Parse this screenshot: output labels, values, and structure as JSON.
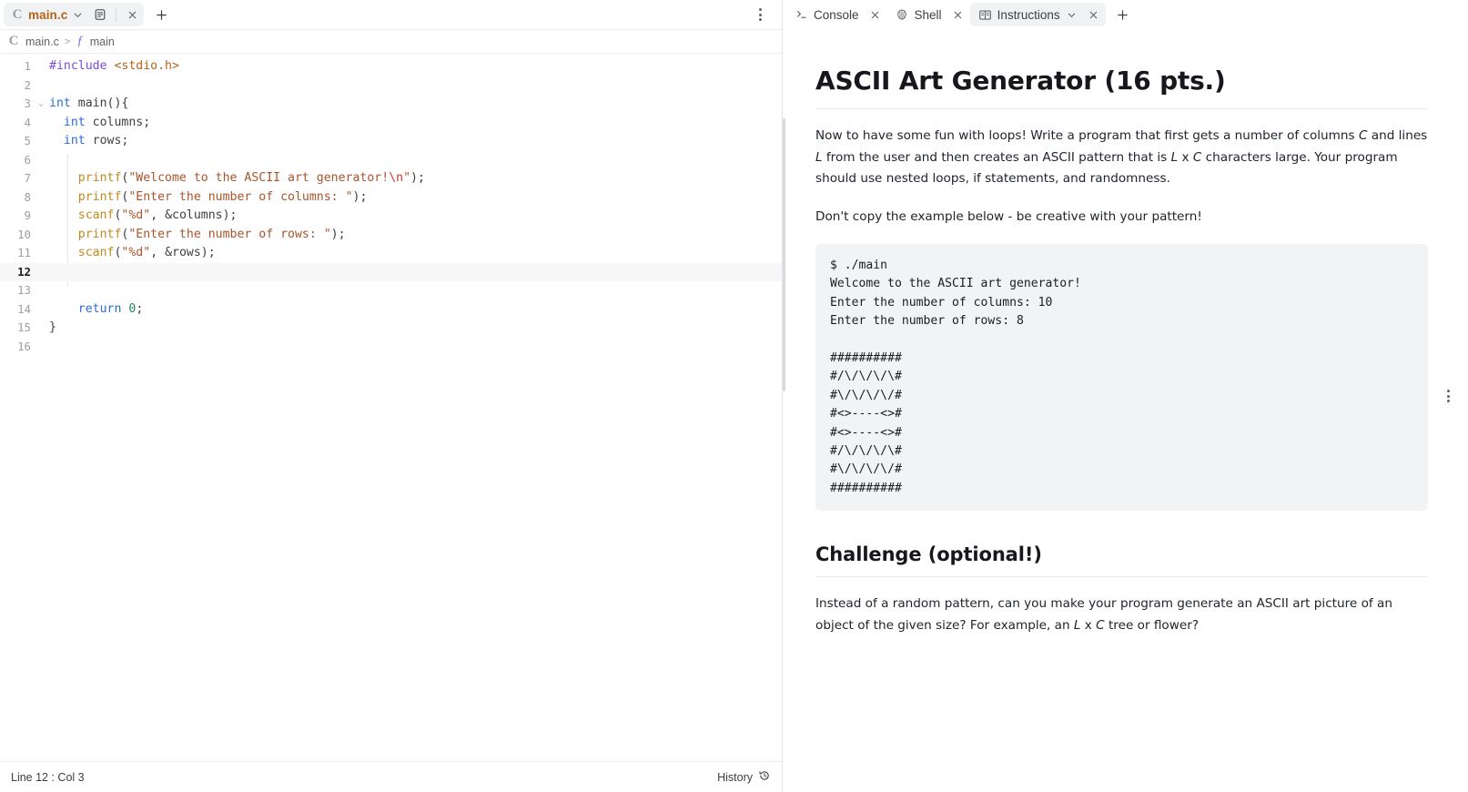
{
  "editor": {
    "tab": {
      "filename": "main.c",
      "language_icon": "c-language-icon",
      "chevron_icon": "chevron-down-icon",
      "preview_icon": "file-preview-icon",
      "close_icon": "close-icon"
    },
    "new_tab_label": "+",
    "breadcrumb": {
      "file": "main.c",
      "separator": ">",
      "symbol": "main",
      "function_glyph": "ƒ"
    },
    "status": {
      "position": "Line 12 : Col 3",
      "history_label": "History"
    },
    "lines": [
      {
        "n": "1",
        "fold": "",
        "current": false,
        "tokens": [
          {
            "t": "#include ",
            "c": "t-pre"
          },
          {
            "t": "<stdio.h>",
            "c": "t-inc"
          }
        ]
      },
      {
        "n": "2",
        "fold": "",
        "current": false,
        "tokens": []
      },
      {
        "n": "3",
        "fold": "v",
        "current": false,
        "tokens": [
          {
            "t": "int",
            "c": "t-kw"
          },
          {
            "t": " main(){",
            "c": "t-punct"
          }
        ]
      },
      {
        "n": "4",
        "fold": "",
        "current": false,
        "tokens": [
          {
            "t": "  ",
            "c": ""
          },
          {
            "t": "int",
            "c": "t-kw"
          },
          {
            "t": " columns;",
            "c": "t-punct"
          }
        ]
      },
      {
        "n": "5",
        "fold": "",
        "current": false,
        "tokens": [
          {
            "t": "  ",
            "c": ""
          },
          {
            "t": "int",
            "c": "t-kw"
          },
          {
            "t": " rows;",
            "c": "t-punct"
          }
        ]
      },
      {
        "n": "6",
        "fold": "",
        "current": false,
        "tokens": []
      },
      {
        "n": "7",
        "fold": "",
        "current": false,
        "tokens": [
          {
            "t": "    ",
            "c": ""
          },
          {
            "t": "printf",
            "c": "t-fn"
          },
          {
            "t": "(",
            "c": "t-punct"
          },
          {
            "t": "\"Welcome to the ASCII art generator!",
            "c": "t-str"
          },
          {
            "t": "\\n",
            "c": "t-esc"
          },
          {
            "t": "\"",
            "c": "t-str"
          },
          {
            "t": ");",
            "c": "t-punct"
          }
        ]
      },
      {
        "n": "8",
        "fold": "",
        "current": false,
        "tokens": [
          {
            "t": "    ",
            "c": ""
          },
          {
            "t": "printf",
            "c": "t-fn"
          },
          {
            "t": "(",
            "c": "t-punct"
          },
          {
            "t": "\"Enter the number of columns: \"",
            "c": "t-str"
          },
          {
            "t": ");",
            "c": "t-punct"
          }
        ]
      },
      {
        "n": "9",
        "fold": "",
        "current": false,
        "tokens": [
          {
            "t": "    ",
            "c": ""
          },
          {
            "t": "scanf",
            "c": "t-fn"
          },
          {
            "t": "(",
            "c": "t-punct"
          },
          {
            "t": "\"%d\"",
            "c": "t-str"
          },
          {
            "t": ", &columns);",
            "c": "t-punct"
          }
        ]
      },
      {
        "n": "10",
        "fold": "",
        "current": false,
        "tokens": [
          {
            "t": "    ",
            "c": ""
          },
          {
            "t": "printf",
            "c": "t-fn"
          },
          {
            "t": "(",
            "c": "t-punct"
          },
          {
            "t": "\"Enter the number of rows: \"",
            "c": "t-str"
          },
          {
            "t": ");",
            "c": "t-punct"
          }
        ]
      },
      {
        "n": "11",
        "fold": "",
        "current": false,
        "tokens": [
          {
            "t": "    ",
            "c": ""
          },
          {
            "t": "scanf",
            "c": "t-fn"
          },
          {
            "t": "(",
            "c": "t-punct"
          },
          {
            "t": "\"%d\"",
            "c": "t-str"
          },
          {
            "t": ", &rows);",
            "c": "t-punct"
          }
        ]
      },
      {
        "n": "12",
        "fold": "",
        "current": true,
        "tokens": []
      },
      {
        "n": "13",
        "fold": "",
        "current": false,
        "tokens": []
      },
      {
        "n": "14",
        "fold": "",
        "current": false,
        "tokens": [
          {
            "t": "    ",
            "c": ""
          },
          {
            "t": "return",
            "c": "t-kw"
          },
          {
            "t": " ",
            "c": ""
          },
          {
            "t": "0",
            "c": "t-num"
          },
          {
            "t": ";",
            "c": "t-punct"
          }
        ]
      },
      {
        "n": "15",
        "fold": "",
        "current": false,
        "tokens": [
          {
            "t": "}",
            "c": "t-punct"
          }
        ]
      },
      {
        "n": "16",
        "fold": "",
        "current": false,
        "tokens": []
      }
    ]
  },
  "right_panel": {
    "tabs": [
      {
        "label": "Console",
        "icon": "console-prompt-icon",
        "active": false,
        "has_chevron": false
      },
      {
        "label": "Shell",
        "icon": "shell-icon",
        "active": false,
        "has_chevron": false
      },
      {
        "label": "Instructions",
        "icon": "book-icon",
        "active": true,
        "has_chevron": true
      }
    ],
    "new_tab_label": "+",
    "close_icon": "close-icon",
    "instructions": {
      "title": "ASCII Art Generator (16 pts.)",
      "para1_a": "Now to have some fun with loops! Write a program that first gets a number of columns ",
      "para1_C": "C",
      "para1_b": " and lines ",
      "para1_L": "L",
      "para1_c": " from the user and then creates an ASCII pattern that is ",
      "para1_L2": "L",
      "para1_x": " x ",
      "para1_C2": "C",
      "para1_d": " characters large. Your program should use nested loops, if statements, and randomness.",
      "para2": "Don't copy the example below - be creative with your pattern!",
      "example_code": "$ ./main\nWelcome to the ASCII art generator!\nEnter the number of columns: 10\nEnter the number of rows: 8\n\n##########\n#/\\/\\/\\/\\#\n#\\/\\/\\/\\/#\n#<>----<>#\n#<>----<>#\n#/\\/\\/\\/\\#\n#\\/\\/\\/\\/#\n##########",
      "challenge_title": "Challenge (optional!)",
      "challenge_a": "Instead of a random pattern, can you make your program generate an ASCII art picture of an object of the given size? For example, an ",
      "challenge_L": "L",
      "challenge_x": " x ",
      "challenge_C": "C",
      "challenge_b": " tree or flower?"
    }
  }
}
